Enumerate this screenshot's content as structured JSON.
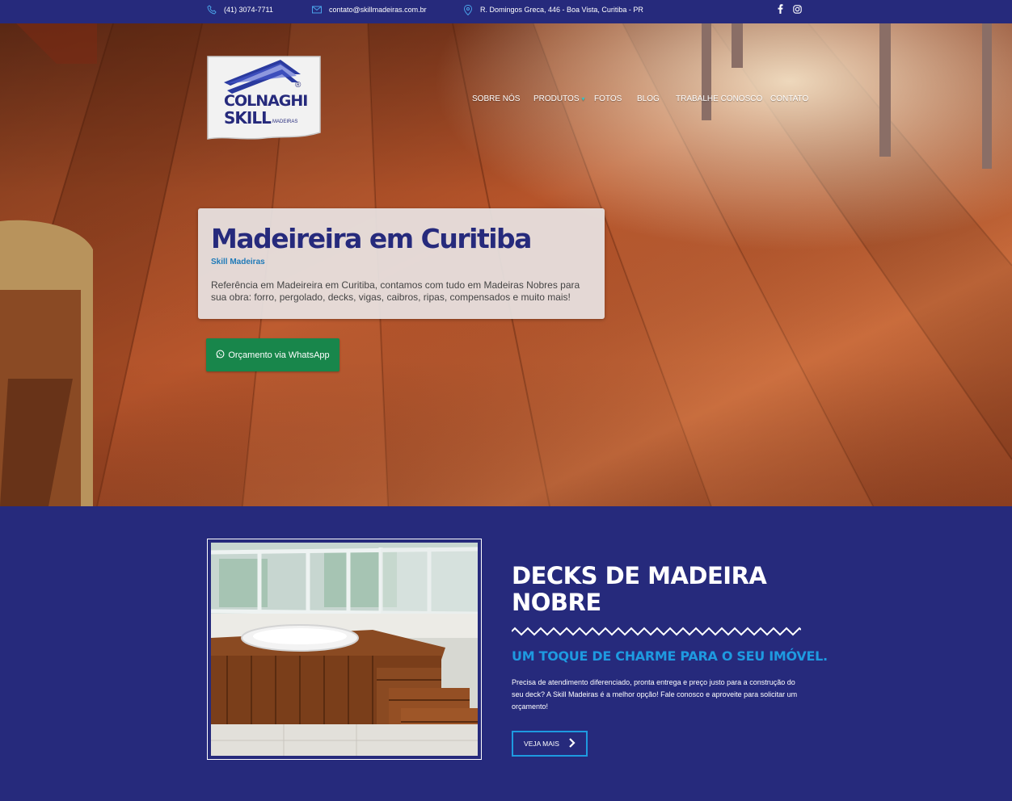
{
  "colors": {
    "brand_navy": "#262a7c",
    "accent_blue": "#1e9ae0",
    "whatsapp_green": "#18864b"
  },
  "topbar": {
    "phone": "(41) 3074-7711",
    "email": "contato@skillmadeiras.com.br",
    "address": "R. Domingos Greca, 446 - Boa Vista, Curitiba - PR",
    "icons": [
      "phone-icon",
      "mail-icon",
      "map-pin-icon",
      "facebook-icon",
      "instagram-icon"
    ]
  },
  "logo": {
    "line1": "COLNAGHI",
    "line2": "SKILL",
    "line3": "MADEIRAS",
    "mark": "®"
  },
  "nav": {
    "items": [
      {
        "label": "SOBRE NÓS"
      },
      {
        "label": "PRODUTOS",
        "has_dropdown": true
      },
      {
        "label": "FOTOS"
      },
      {
        "label": "BLOG"
      },
      {
        "label": "TRABALHE CONOSCO"
      },
      {
        "label": "CONTATO"
      }
    ]
  },
  "hero": {
    "title": "Madeireira em Curitiba",
    "subtitle": "Skill Madeiras",
    "description": "Referência em Madeireira em Curitiba, contamos com tudo em Madeiras Nobres para sua obra: forro, pergolado, decks, vigas, caibros, ripas, compensados e muito mais!",
    "cta": "Orçamento via WhatsApp"
  },
  "feature": {
    "heading_line1": "DECKS DE MADEIRA",
    "heading_line2": "NOBRE",
    "tagline": "UM TOQUE DE CHARME PARA O SEU IMÓVEL.",
    "text": "Precisa de atendimento diferenciado, pronta entrega e preço justo para a construção do seu deck? A Skill Madeiras é a melhor opção! Fale conosco e aproveite para solicitar um orçamento!",
    "button": "VEJA MAIS"
  }
}
